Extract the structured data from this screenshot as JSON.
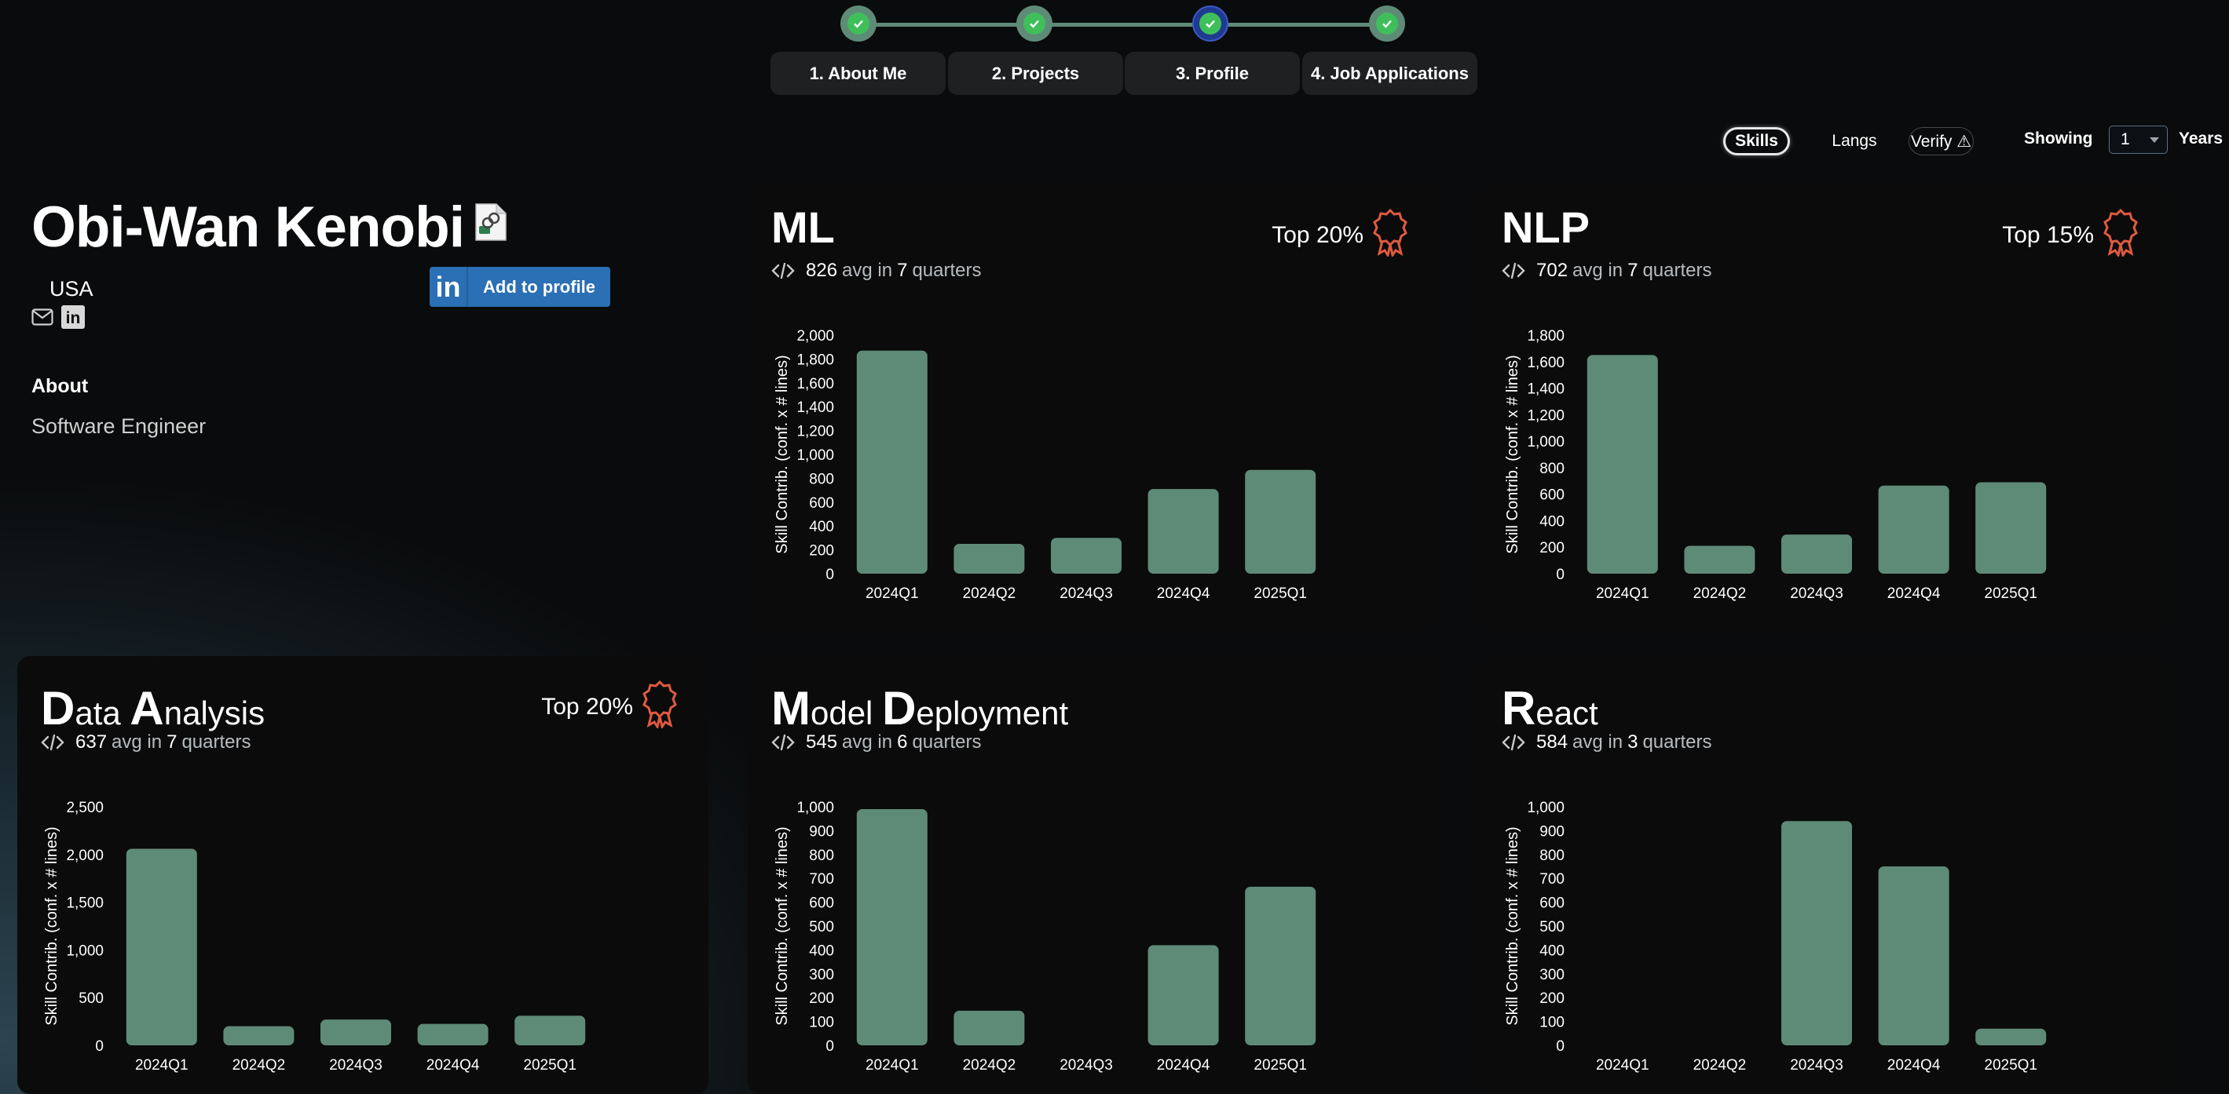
{
  "stepper": {
    "steps": [
      {
        "label": "1. About Me",
        "state": "done"
      },
      {
        "label": "2. Projects",
        "state": "done"
      },
      {
        "label": "3. Profile",
        "state": "active"
      },
      {
        "label": "4. Job Applications",
        "state": "done"
      }
    ]
  },
  "toolbar": {
    "tabs": [
      {
        "label": "Skills",
        "active": true
      },
      {
        "label": "Langs",
        "active": false
      },
      {
        "label": "Verify ⚠",
        "active": false
      }
    ],
    "showing_label": "Showing",
    "years_value": "1",
    "years_label": "Years"
  },
  "profile": {
    "name": "Obi-Wan Kenobi",
    "country": "USA",
    "linkedin_button": "Add to profile",
    "about_heading": "About",
    "about_text": "Software Engineer"
  },
  "colors": {
    "bar": "#5e8b78",
    "badge": "#e05a40",
    "card_bg": "#0b0b0b",
    "step_done": "#5e8b78",
    "step_active": "#1f3b8f",
    "linkedin": "#2b6fb4"
  },
  "cards": [
    {
      "title": "ML",
      "title_style": "plain",
      "avg": "826",
      "avg_text": "avg in",
      "quarters": "7",
      "quarters_text": "quarters",
      "top": "Top 20%",
      "chart_data": {
        "type": "bar",
        "categories": [
          "2024Q1",
          "2024Q2",
          "2024Q3",
          "2024Q4",
          "2025Q1"
        ],
        "values": [
          1870,
          250,
          300,
          710,
          870
        ],
        "ylabel": "Skill Contrib. (conf. x # lines)",
        "ylim": [
          0,
          2000
        ],
        "yticks": [
          "0",
          "200",
          "400",
          "600",
          "800",
          "1,000",
          "1,200",
          "1,400",
          "1,600",
          "1,800",
          "2,000"
        ],
        "ytick_values": [
          0,
          200,
          400,
          600,
          800,
          1000,
          1200,
          1400,
          1600,
          1800,
          2000
        ]
      }
    },
    {
      "title": "NLP",
      "title_style": "plain",
      "avg": "702",
      "avg_text": "avg in",
      "quarters": "7",
      "quarters_text": "quarters",
      "top": "Top 15%",
      "chart_data": {
        "type": "bar",
        "categories": [
          "2024Q1",
          "2024Q2",
          "2024Q3",
          "2024Q4",
          "2025Q1"
        ],
        "values": [
          1650,
          210,
          295,
          665,
          690
        ],
        "ylabel": "Skill Contrib. (conf. x # lines)",
        "ylim": [
          0,
          1800
        ],
        "yticks": [
          "0",
          "200",
          "400",
          "600",
          "800",
          "1,000",
          "1,200",
          "1,400",
          "1,600",
          "1,800"
        ],
        "ytick_values": [
          0,
          200,
          400,
          600,
          800,
          1000,
          1200,
          1400,
          1600,
          1800
        ]
      }
    },
    {
      "title_parts": [
        "D",
        "ata ",
        "A",
        "nalysis"
      ],
      "title_style": "cap",
      "avg": "637",
      "avg_text": "avg in",
      "quarters": "7",
      "quarters_text": "quarters",
      "top": "Top 20%",
      "chart_data": {
        "type": "bar",
        "categories": [
          "2024Q1",
          "2024Q2",
          "2024Q3",
          "2024Q4",
          "2025Q1"
        ],
        "values": [
          2060,
          200,
          270,
          225,
          310
        ],
        "ylabel": "Skill Contrib. (conf. x # lines)",
        "ylim": [
          0,
          2500
        ],
        "yticks": [
          "0",
          "500",
          "1,000",
          "1,500",
          "2,000",
          "2,500"
        ],
        "ytick_values": [
          0,
          500,
          1000,
          1500,
          2000,
          2500
        ]
      }
    },
    {
      "title_parts": [
        "M",
        "odel ",
        "D",
        "eployment"
      ],
      "title_style": "cap",
      "avg": "545",
      "avg_text": "avg in",
      "quarters": "6",
      "quarters_text": "quarters",
      "top": "",
      "chart_data": {
        "type": "bar",
        "categories": [
          "2024Q1",
          "2024Q2",
          "2024Q3",
          "2024Q4",
          "2025Q1"
        ],
        "values": [
          990,
          145,
          0,
          420,
          665
        ],
        "ylabel": "Skill Contrib. (conf. x # lines)",
        "ylim": [
          0,
          1000
        ],
        "yticks": [
          "0",
          "100",
          "200",
          "300",
          "400",
          "500",
          "600",
          "700",
          "800",
          "900",
          "1,000"
        ],
        "ytick_values": [
          0,
          100,
          200,
          300,
          400,
          500,
          600,
          700,
          800,
          900,
          1000
        ]
      }
    },
    {
      "title_parts": [
        "R",
        "eact"
      ],
      "title_style": "cap",
      "avg": "584",
      "avg_text": "avg in",
      "quarters": "3",
      "quarters_text": "quarters",
      "top": "",
      "chart_data": {
        "type": "bar",
        "categories": [
          "2024Q1",
          "2024Q2",
          "2024Q3",
          "2024Q4",
          "2025Q1"
        ],
        "values": [
          0,
          0,
          940,
          750,
          70
        ],
        "ylabel": "Skill Contrib. (conf. x # lines)",
        "ylim": [
          0,
          1000
        ],
        "yticks": [
          "0",
          "100",
          "200",
          "300",
          "400",
          "500",
          "600",
          "700",
          "800",
          "900",
          "1,000"
        ],
        "ytick_values": [
          0,
          100,
          200,
          300,
          400,
          500,
          600,
          700,
          800,
          900,
          1000
        ]
      }
    }
  ]
}
